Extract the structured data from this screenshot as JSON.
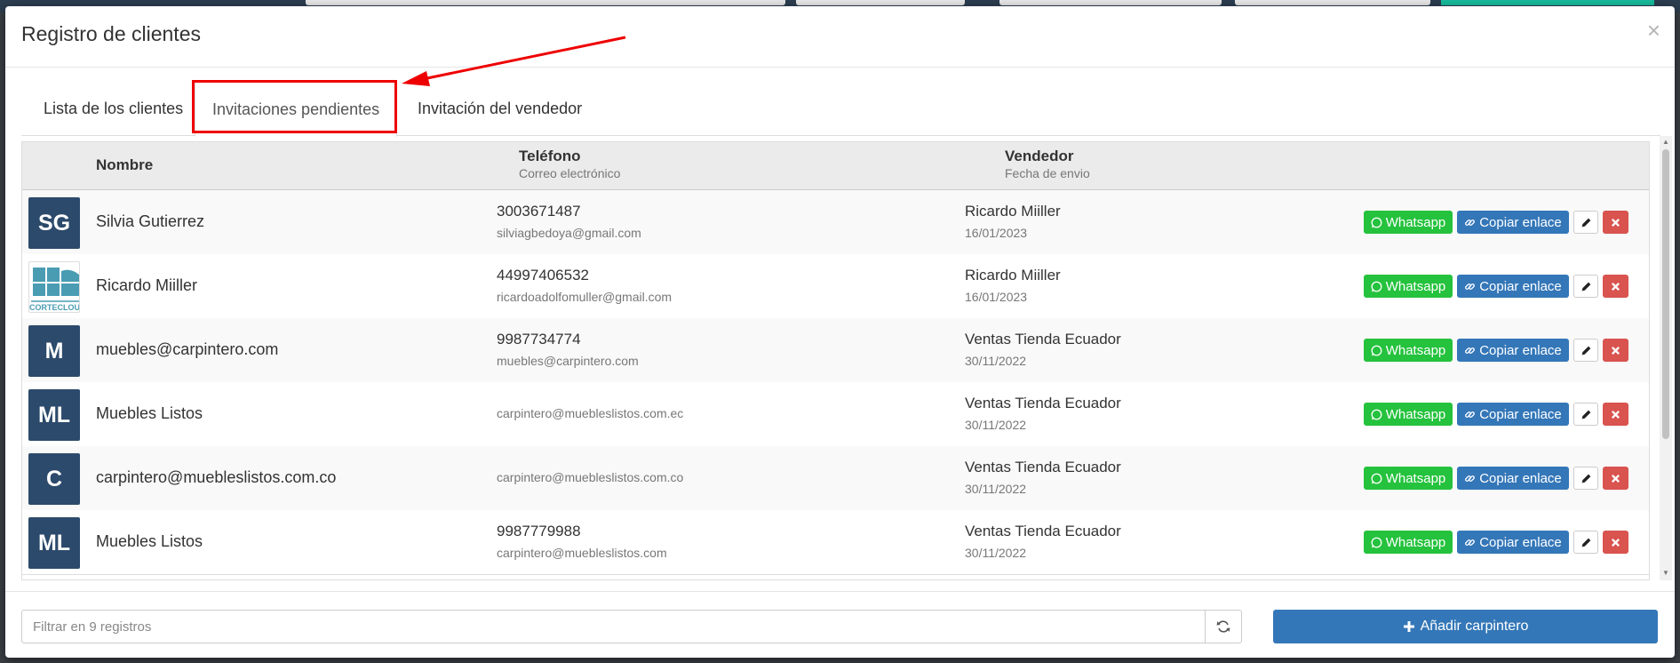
{
  "modal": {
    "title": "Registro de clientes",
    "close_glyph": "×"
  },
  "tabs": [
    {
      "label": "Lista de los clientes"
    },
    {
      "label": "Invitaciones pendientes",
      "active": true
    },
    {
      "label": "Invitación del vendedor"
    }
  ],
  "table": {
    "headers": {
      "nombre": "Nombre",
      "telefono": "Teléfono",
      "correo": "Correo electrónico",
      "vendedor": "Vendedor",
      "fecha": "Fecha de envio"
    },
    "rows": [
      {
        "initials": "SG",
        "name": "Silvia Gutierrez",
        "phone": "3003671487",
        "email": "silviagbedoya@gmail.com",
        "seller": "Ricardo Miiller",
        "date": "16/01/2023"
      },
      {
        "initials": "",
        "logo_text": "CORTECLOUD",
        "name": "Ricardo Miiller",
        "phone": "44997406532",
        "email": "ricardoadolfomuller@gmail.com",
        "seller": "Ricardo Miiller",
        "date": "16/01/2023"
      },
      {
        "initials": "M",
        "name": "muebles@carpintero.com",
        "phone": "9987734774",
        "email": "muebles@carpintero.com",
        "seller": "Ventas Tienda Ecuador",
        "date": "30/11/2022"
      },
      {
        "initials": "ML",
        "name": "Muebles Listos",
        "phone": "",
        "email": "carpintero@muebleslistos.com.ec",
        "seller": "Ventas Tienda Ecuador",
        "date": "30/11/2022"
      },
      {
        "initials": "C",
        "name": "carpintero@muebleslistos.com.co",
        "phone": "",
        "email": "carpintero@muebleslistos.com.co",
        "seller": "Ventas Tienda Ecuador",
        "date": "30/11/2022"
      },
      {
        "initials": "ML",
        "name": "Muebles Listos",
        "phone": "9987779988",
        "email": "carpintero@muebleslistos.com",
        "seller": "Ventas Tienda Ecuador",
        "date": "30/11/2022"
      }
    ],
    "actions": {
      "whatsapp": "Whatsapp",
      "copy": "Copiar enlace"
    }
  },
  "footer": {
    "filter_placeholder": "Filtrar en 9 registros",
    "add_button": "Añadir carpintero"
  },
  "icons": {
    "whatsapp": "whatsapp-icon",
    "link": "link-icon",
    "edit": "pencil-icon",
    "delete": "close-icon",
    "refresh": "refresh-icon",
    "add": "plus-icon"
  },
  "colors": {
    "avatar": "#2c4a6b",
    "whatsapp": "#25c23d",
    "primary": "#3477b8",
    "danger": "#d9534f",
    "highlight": "#ee0000"
  }
}
